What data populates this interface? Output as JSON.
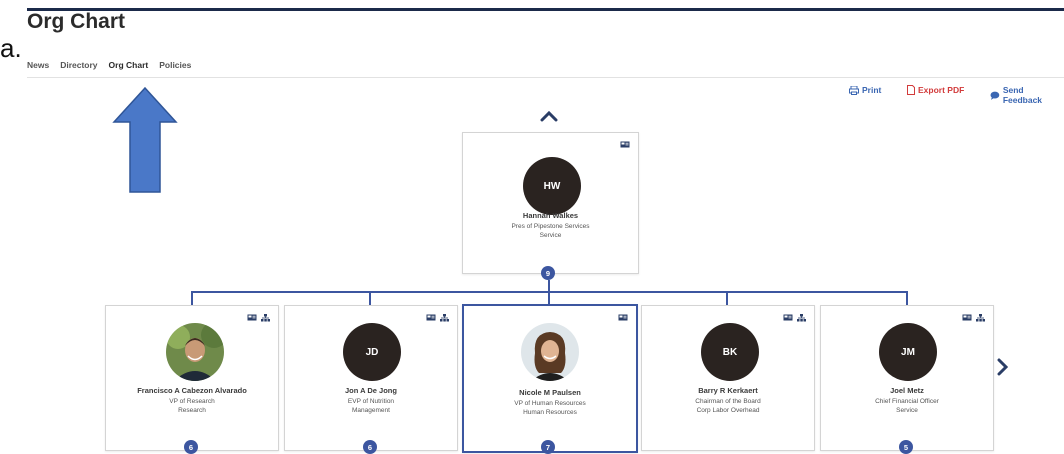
{
  "page": {
    "title": "Org Chart",
    "stray_char": "a."
  },
  "tabs": [
    {
      "label": "News"
    },
    {
      "label": "Directory"
    },
    {
      "label": "Org Chart",
      "active": true
    },
    {
      "label": "Policies"
    }
  ],
  "actions": {
    "print": "Print",
    "export_pdf": "Export PDF",
    "send_feedback": "Send Feedback"
  },
  "colors": {
    "accent": "#3c56a0",
    "link": "#3a66b2",
    "pdf": "#d23b3b",
    "arrow": "#4a78c8"
  },
  "root": {
    "initials": "HW",
    "name": "Hannah Walkes",
    "title": "Pres of Pipestone Services",
    "department": "Service",
    "reports": "9",
    "icons": [
      "contact-card-icon"
    ]
  },
  "children": [
    {
      "name": "Francisco A Cabezon Alvarado",
      "title": "VP of Research",
      "department": "Research",
      "reports": "6",
      "avatar": "photo",
      "icons": [
        "contact-card-icon",
        "org-tree-icon"
      ]
    },
    {
      "initials": "JD",
      "name": "Jon A De Jong",
      "title": "EVP of Nutrition",
      "department": "Management",
      "reports": "6",
      "avatar": "initials",
      "icons": [
        "contact-card-icon",
        "org-tree-icon"
      ]
    },
    {
      "name": "Nicole M Paulsen",
      "title": "VP of Human Resources",
      "department": "Human Resources",
      "reports": "7",
      "avatar": "photo",
      "selected": true,
      "icons": [
        "contact-card-icon"
      ]
    },
    {
      "initials": "BK",
      "name": "Barry R Kerkaert",
      "title": "Chairman of the Board",
      "department": "Corp Labor Overhead",
      "avatar": "initials",
      "icons": [
        "contact-card-icon",
        "org-tree-icon"
      ]
    },
    {
      "initials": "JM",
      "name": "Joel Metz",
      "title": "Chief Financial Officer",
      "department": "Service",
      "reports": "5",
      "avatar": "initials",
      "icons": [
        "contact-card-icon",
        "org-tree-icon"
      ]
    }
  ]
}
